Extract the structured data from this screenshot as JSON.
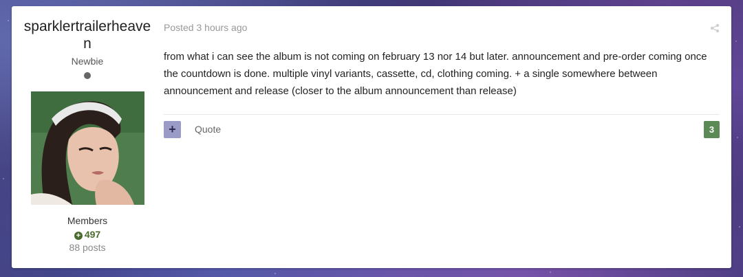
{
  "author": {
    "name": "sparklertrailerheaven",
    "rank": "Newbie",
    "group": "Members",
    "reputation": "497",
    "post_count": "88 posts",
    "avatar_icon": "user-avatar-photo"
  },
  "post": {
    "meta": "Posted 3 hours ago",
    "body": "from what i can see the album is not coming on february 13 nor 14 but later. announcement and pre-order coming once the countdown is done. multiple vinyl variants, cassette, cd, clothing coming. + a single somewhere between announcement and release (closer to the album announcement than release)",
    "share_icon": "share-icon"
  },
  "controls": {
    "multiquote_label": "+",
    "quote_label": "Quote",
    "reaction_count": "3"
  },
  "colors": {
    "reputation_green": "#4a6b2f",
    "badge_green": "#5b8a56",
    "multiquote_purple": "#9b9bc8"
  }
}
